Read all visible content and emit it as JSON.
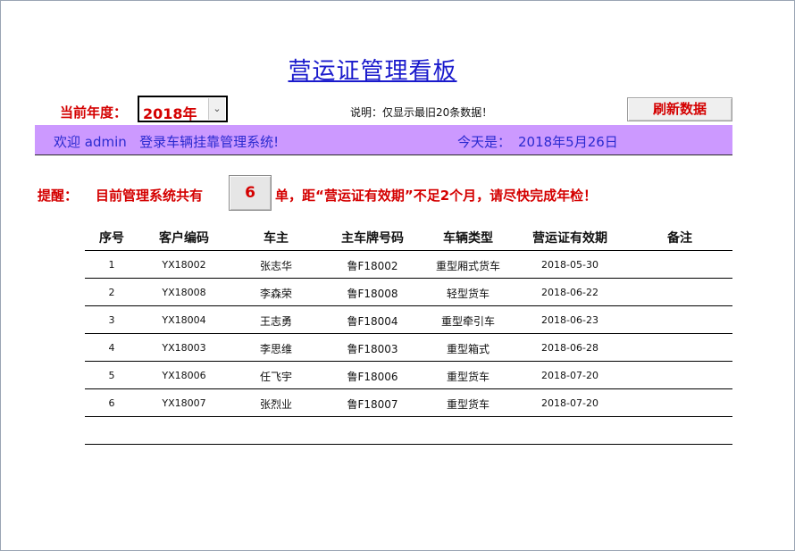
{
  "header": {
    "title": "营运证管理看板"
  },
  "controls": {
    "year_label": "当前年度：",
    "year_value": "2018年",
    "note": "说明：仅显示最旧20条数据！",
    "refresh_label": "刷新数据"
  },
  "welcome": {
    "text": "欢迎 admin   登录车辆挂靠管理系统!",
    "today_label": "今天是：",
    "today_date": "2018年5月26日"
  },
  "reminder": {
    "label": "提醒：",
    "prefix": "目前管理系统共有",
    "count": "6",
    "suffix": "单，距“营运证有效期”不足2个月，请尽快完成年检！"
  },
  "table": {
    "columns": [
      "序号",
      "客户编码",
      "车主",
      "主车牌号码",
      "车辆类型",
      "营运证有效期",
      "备注"
    ],
    "rows": [
      [
        "1",
        "YX18002",
        "张志华",
        "鲁F18002",
        "重型厢式货车",
        "2018-05-30",
        ""
      ],
      [
        "2",
        "YX18008",
        "李森荣",
        "鲁F18008",
        "轻型货车",
        "2018-06-22",
        ""
      ],
      [
        "3",
        "YX18004",
        "王志勇",
        "鲁F18004",
        "重型牵引车",
        "2018-06-23",
        ""
      ],
      [
        "4",
        "YX18003",
        "李思维",
        "鲁F18003",
        "重型箱式",
        "2018-06-28",
        ""
      ],
      [
        "5",
        "YX18006",
        "任飞宇",
        "鲁F18006",
        "重型货车",
        "2018-07-20",
        ""
      ],
      [
        "6",
        "YX18007",
        "张烈业",
        "鲁F18007",
        "重型货车",
        "2018-07-20",
        ""
      ],
      [
        "",
        "",
        "",
        "",
        "",
        "",
        ""
      ]
    ]
  },
  "colors": {
    "title": "#1a1acc",
    "accent_red": "#d40000",
    "welcome_bg": "#cc99ff",
    "welcome_text": "#2a2ad0"
  },
  "icons": {
    "dropdown": "chevron-down-icon"
  }
}
